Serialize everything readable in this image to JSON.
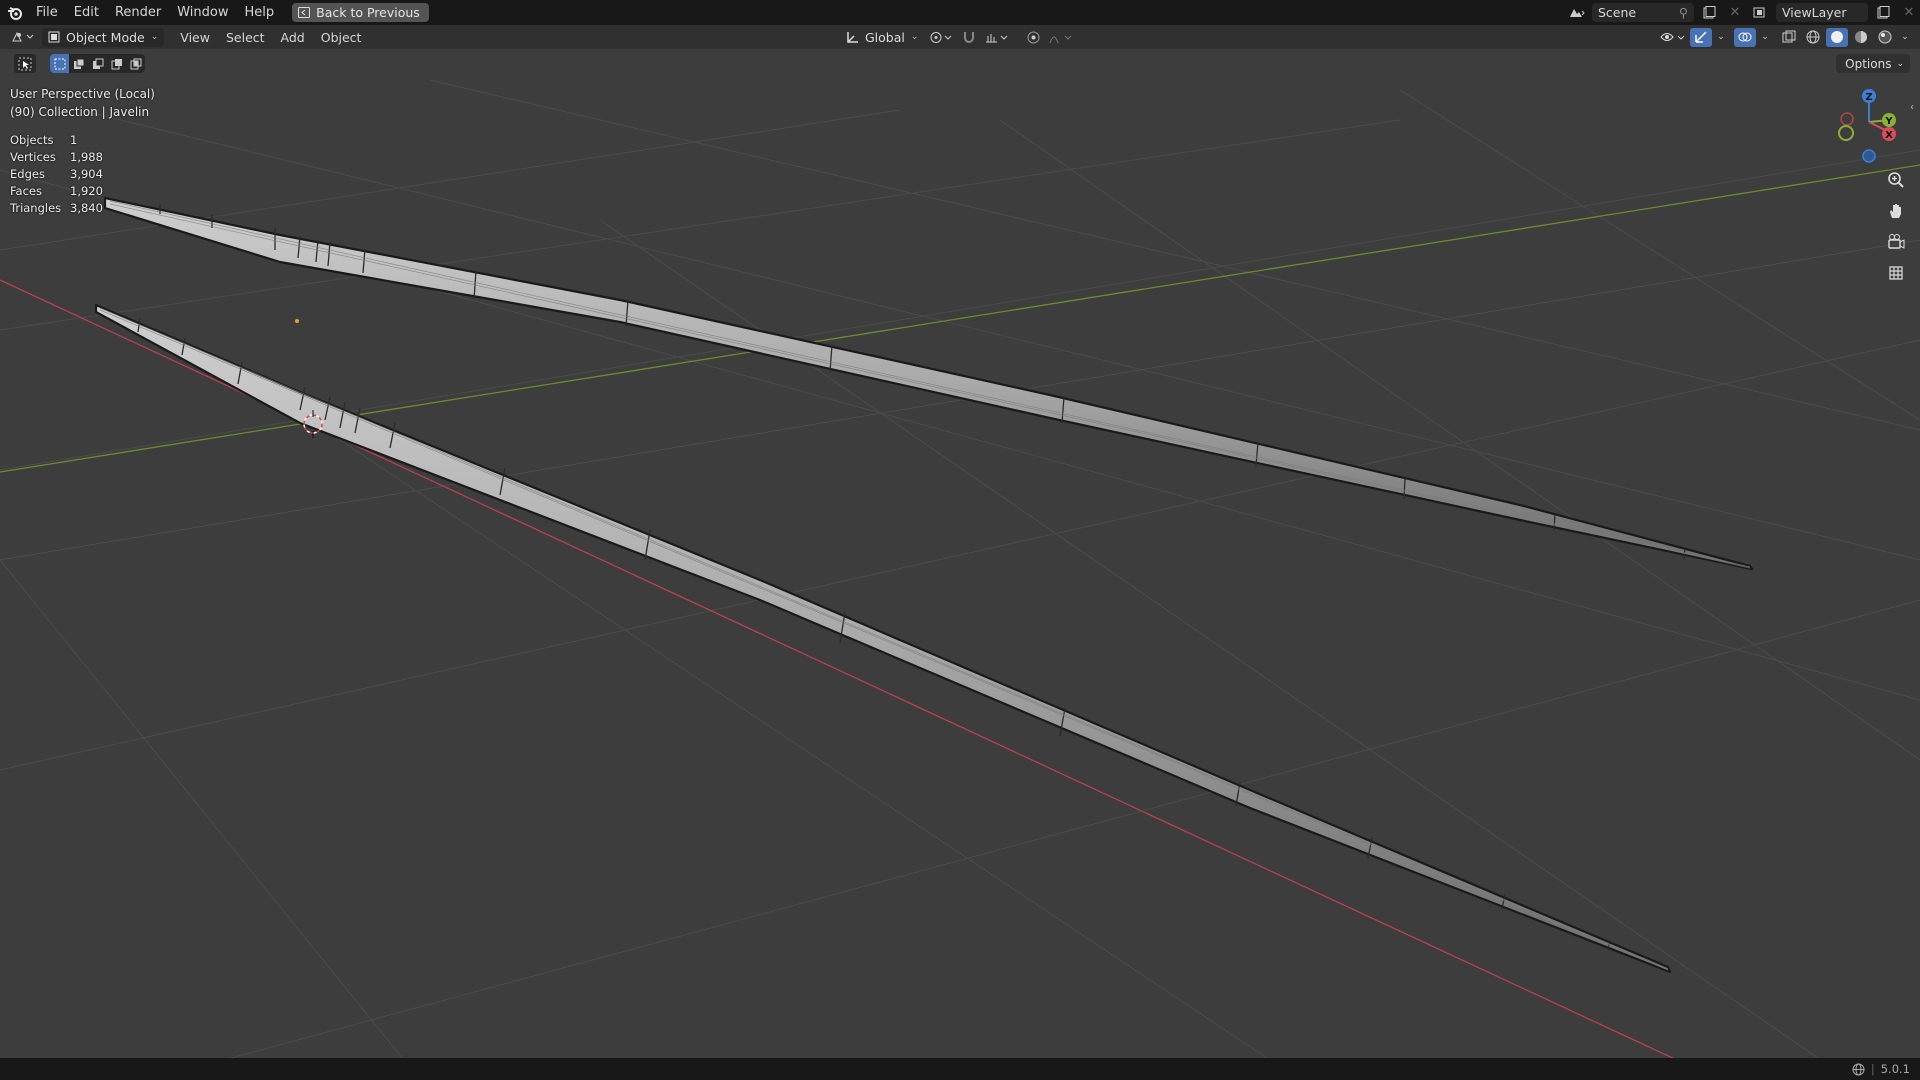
{
  "menubar": {
    "items": [
      "File",
      "Edit",
      "Render",
      "Window",
      "Help"
    ],
    "back_button": "Back to Previous",
    "scene": "Scene",
    "view_layer": "ViewLayer"
  },
  "header": {
    "mode": "Object Mode",
    "menus": [
      "View",
      "Select",
      "Add",
      "Object"
    ],
    "orientation": "Global",
    "options": "Options"
  },
  "viewport": {
    "perspective": "User Perspective (Local)",
    "collection": "(90) Collection | Javelin",
    "stats": [
      {
        "label": "Objects",
        "value": "1"
      },
      {
        "label": "Vertices",
        "value": "1,988"
      },
      {
        "label": "Edges",
        "value": "3,904"
      },
      {
        "label": "Faces",
        "value": "1,920"
      },
      {
        "label": "Triangles",
        "value": "3,840"
      }
    ],
    "gizmo": {
      "x": "X",
      "y": "Y",
      "z": "Z"
    }
  },
  "statusbar": {
    "version": "5.0.1"
  },
  "colors": {
    "x_axis": "#b8414f",
    "y_axis": "#6b8c2a",
    "grid": "#4a4a4a",
    "background": "#3d3d3d"
  }
}
